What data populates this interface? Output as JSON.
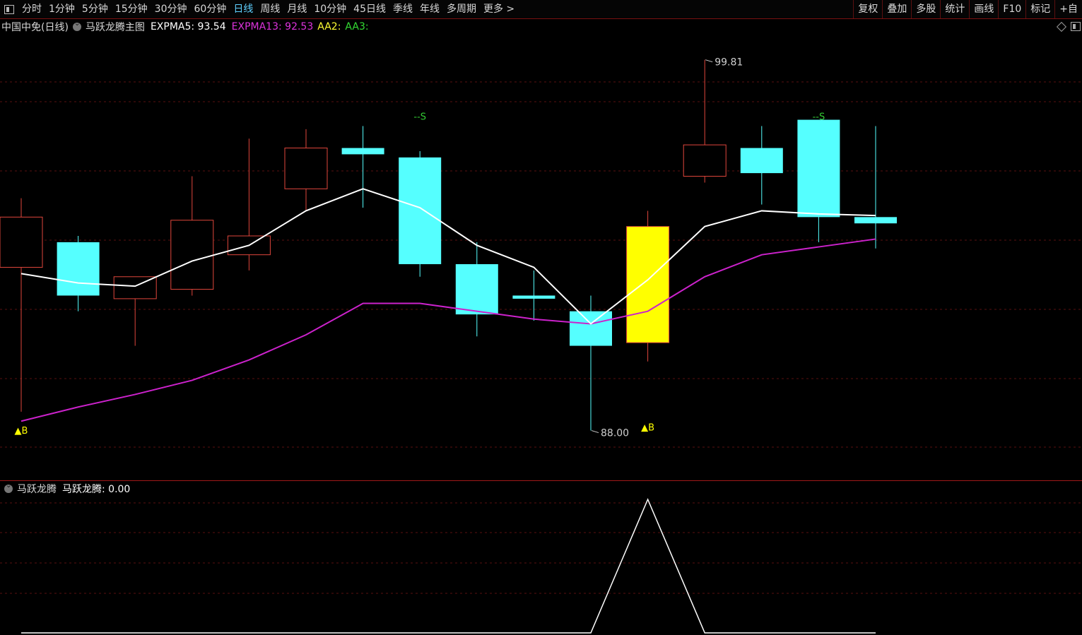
{
  "toolbar": {
    "periods": [
      "分时",
      "1分钟",
      "5分钟",
      "15分钟",
      "30分钟",
      "60分钟",
      "日线",
      "周线",
      "月线",
      "10分钟",
      "45日线",
      "季线",
      "年线",
      "多周期",
      "更多 >"
    ],
    "active_period": "日线",
    "right_buttons": [
      "复权",
      "叠加",
      "多股",
      "统计",
      "画线",
      "F10",
      "标记",
      "+自"
    ]
  },
  "main_title": {
    "stock": "中国中免(日线)",
    "indicator": "马跃龙腾主图",
    "expma5_label": "EXPMA5: 93.54",
    "expma13_label": "EXPMA13: 92.53",
    "aa2_label": "AA2:",
    "aa3_label": "AA3:"
  },
  "sub_title": {
    "name": "马跃龙腾",
    "value_label": "马跃龙腾: 0.00"
  },
  "colors": {
    "up": "#e0463c",
    "down": "#55ffff",
    "highlight": "#ffff00",
    "expma5": "#ffffff",
    "expma13": "#cc22cc",
    "signal_b": "#ffff00",
    "signal_s": "#33cc33",
    "expma13_text": "#dd33dd",
    "aa2_text": "#ffff33",
    "aa3_text": "#33dd33"
  },
  "chart_data": {
    "type": "candlestick",
    "y_range": [
      87.0,
      100.5
    ],
    "candles": [
      {
        "open": 93.2,
        "high": 95.4,
        "low": 88.6,
        "close": 94.8,
        "dir": "up"
      },
      {
        "open": 94.0,
        "high": 94.2,
        "low": 91.8,
        "close": 92.3,
        "dir": "down"
      },
      {
        "open": 92.2,
        "high": 92.6,
        "low": 90.7,
        "close": 92.9,
        "dir": "up"
      },
      {
        "open": 92.5,
        "high": 96.1,
        "low": 92.3,
        "close": 94.7,
        "dir": "up"
      },
      {
        "open": 93.6,
        "high": 97.3,
        "low": 93.1,
        "close": 94.2,
        "dir": "up"
      },
      {
        "open": 95.7,
        "high": 97.6,
        "low": 95.0,
        "close": 97.0,
        "dir": "up"
      },
      {
        "open": 97.0,
        "high": 97.7,
        "low": 95.1,
        "close": 96.8,
        "dir": "down"
      },
      {
        "open": 96.7,
        "high": 96.9,
        "low": 92.9,
        "close": 93.3,
        "dir": "down"
      },
      {
        "open": 93.3,
        "high": 94.0,
        "low": 91.0,
        "close": 91.7,
        "dir": "down"
      },
      {
        "open": 92.3,
        "high": 93.1,
        "low": 91.5,
        "close": 92.2,
        "dir": "down"
      },
      {
        "open": 91.8,
        "high": 92.3,
        "low": 88.0,
        "close": 90.7,
        "dir": "down"
      },
      {
        "open": 94.5,
        "high": 95.0,
        "low": 90.2,
        "close": 90.8,
        "dir": "highlight"
      },
      {
        "open": 96.1,
        "high": 99.81,
        "low": 95.9,
        "close": 97.1,
        "dir": "up"
      },
      {
        "open": 97.0,
        "high": 97.7,
        "low": 95.2,
        "close": 96.2,
        "dir": "down"
      },
      {
        "open": 97.9,
        "high": 97.7,
        "low": 94.0,
        "close": 94.8,
        "dir": "down"
      },
      {
        "open": 94.8,
        "high": 97.7,
        "low": 93.8,
        "close": 94.6,
        "dir": "down"
      }
    ],
    "expma5": [
      93.0,
      92.7,
      92.6,
      93.4,
      93.9,
      95.0,
      95.7,
      95.1,
      93.9,
      93.2,
      91.4,
      92.8,
      94.5,
      95.0,
      94.9,
      94.85
    ],
    "expma13": [
      88.3,
      88.75,
      89.15,
      89.6,
      90.25,
      91.05,
      92.05,
      92.05,
      91.8,
      91.55,
      91.4,
      91.8,
      92.9,
      93.6,
      93.85,
      94.1
    ],
    "price_labels": [
      {
        "index": 12,
        "value": "99.81",
        "at": "high"
      },
      {
        "index": 10,
        "value": "88.00",
        "at": "low"
      }
    ],
    "signals": [
      {
        "index": 0,
        "label": "▲B",
        "value": 87.9,
        "kind": "B"
      },
      {
        "index": 11,
        "label": "▲B",
        "value": 88.0,
        "kind": "B"
      },
      {
        "index": 7,
        "label": "--S",
        "value": 97.9,
        "kind": "S"
      },
      {
        "index": 14,
        "label": "--S",
        "value": 97.9,
        "kind": "S"
      }
    ],
    "sub_indicator": {
      "y_range": [
        0,
        1
      ],
      "values": [
        0,
        0,
        0,
        0,
        0,
        0,
        0,
        0,
        0,
        0,
        0,
        1,
        0,
        0,
        0,
        0
      ]
    }
  }
}
